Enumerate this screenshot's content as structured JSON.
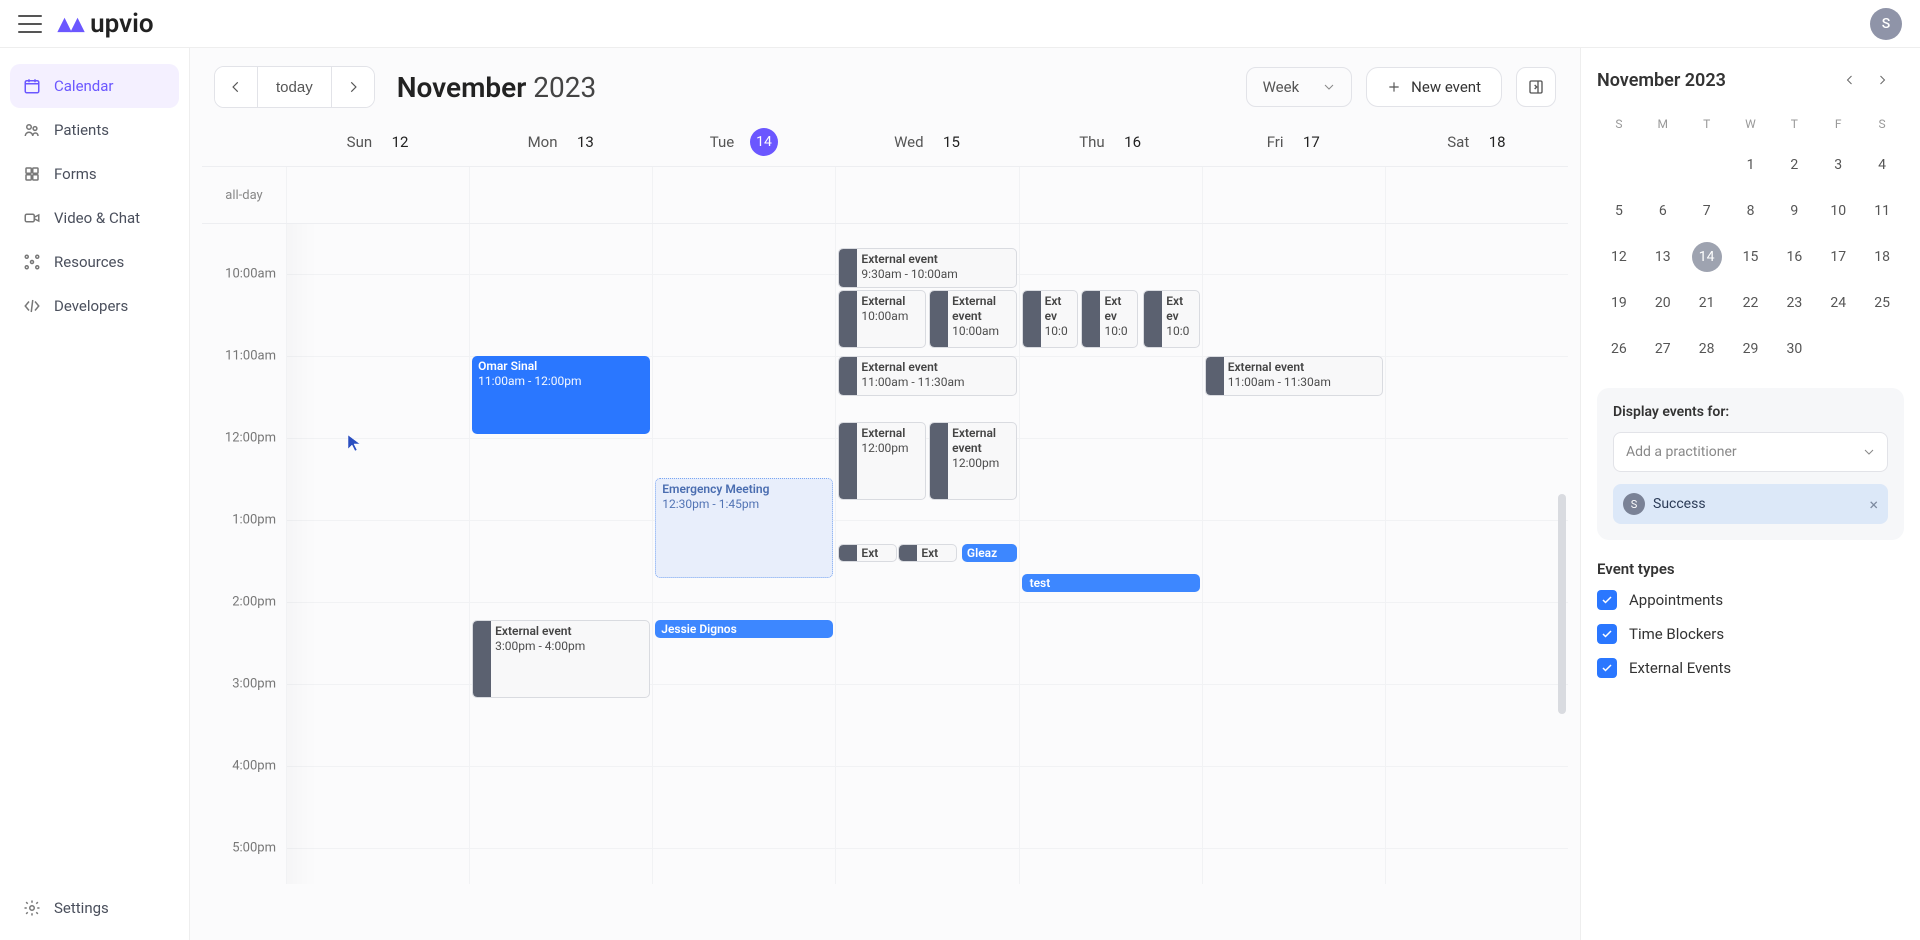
{
  "brand": "upvio",
  "avatar_initial": "S",
  "sidebar": {
    "items": [
      {
        "label": "Calendar"
      },
      {
        "label": "Patients"
      },
      {
        "label": "Forms"
      },
      {
        "label": "Video & Chat"
      },
      {
        "label": "Resources"
      },
      {
        "label": "Developers"
      }
    ],
    "footer": "Settings"
  },
  "header": {
    "today": "today",
    "month": "November",
    "year": "2023",
    "view": "Week",
    "new_event": "New event"
  },
  "days": [
    {
      "abbr": "Sun",
      "num": "12"
    },
    {
      "abbr": "Mon",
      "num": "13"
    },
    {
      "abbr": "Tue",
      "num": "14"
    },
    {
      "abbr": "Wed",
      "num": "15"
    },
    {
      "abbr": "Thu",
      "num": "16"
    },
    {
      "abbr": "Fri",
      "num": "17"
    },
    {
      "abbr": "Sat",
      "num": "18"
    }
  ],
  "allday_label": "all-day",
  "hours": [
    "10:00am",
    "11:00am",
    "12:00pm",
    "1:00pm",
    "2:00pm",
    "3:00pm",
    "4:00pm",
    "5:00pm"
  ],
  "events": {
    "omar": {
      "title": "Omar Sinal",
      "time": "11:00am - 12:00pm"
    },
    "emerg": {
      "title": "Emergency Meeting",
      "time": "12:30pm - 1:45pm"
    },
    "mon_ext": {
      "title": "External event",
      "time": "3:00pm - 4:00pm"
    },
    "jessie": {
      "title": "Jessie Dignos"
    },
    "tue_ext1": {
      "title": "Ext"
    },
    "tue_ext2": {
      "title": "Ext"
    },
    "tue_gleaz": {
      "title": "Gleaz"
    },
    "wed_930": {
      "title": "External event",
      "time": "9:30am - 10:00am"
    },
    "wed_10a": {
      "title": "External",
      "time": "10:00am"
    },
    "wed_10b": {
      "title": "External event",
      "time": "10:00am"
    },
    "wed_11": {
      "title": "External event",
      "time": "11:00am - 11:30am"
    },
    "wed_12a": {
      "title": "External",
      "time": "12:00pm"
    },
    "wed_12b": {
      "title": "External event",
      "time": "12:00pm"
    },
    "thu_10a": {
      "title": "Ext ev",
      "time": "10:0"
    },
    "thu_10b": {
      "title": "Ext ev",
      "time": "10:0"
    },
    "thu_10c": {
      "title": "Ext ev",
      "time": "10:0"
    },
    "thu_test": {
      "title": "test"
    },
    "fri_11": {
      "title": "External event",
      "time": "11:00am - 11:30am"
    }
  },
  "mini": {
    "title": "November 2023",
    "dow": [
      "S",
      "M",
      "T",
      "W",
      "T",
      "F",
      "S"
    ],
    "weeks": [
      [
        "",
        "",
        "",
        "1",
        "2",
        "3",
        "4"
      ],
      [
        "5",
        "6",
        "7",
        "8",
        "9",
        "10",
        "11"
      ],
      [
        "12",
        "13",
        "14",
        "15",
        "16",
        "17",
        "18"
      ],
      [
        "19",
        "20",
        "21",
        "22",
        "23",
        "24",
        "25"
      ],
      [
        "26",
        "27",
        "28",
        "29",
        "30",
        "",
        ""
      ]
    ],
    "today": "14"
  },
  "filter": {
    "title": "Display events for:",
    "placeholder": "Add a practitioner",
    "chip_initial": "S",
    "chip_name": "Success"
  },
  "eventTypes": {
    "title": "Event types",
    "items": [
      "Appointments",
      "Time Blockers",
      "External Events"
    ]
  }
}
